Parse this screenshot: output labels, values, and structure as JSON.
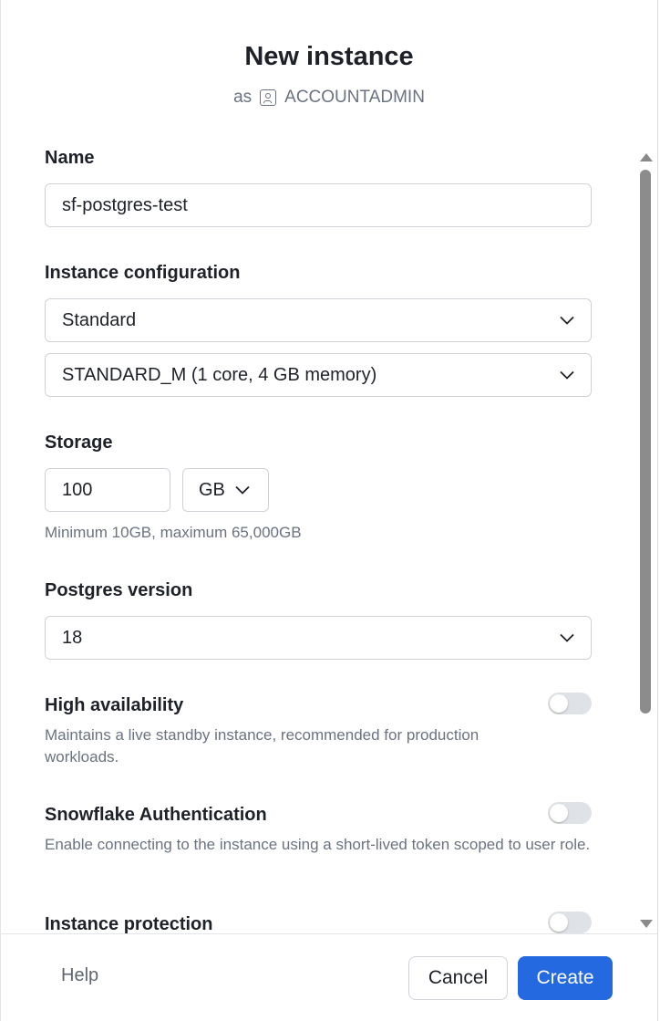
{
  "dialog": {
    "title": "New instance",
    "subtitle_prefix": "as",
    "role": "ACCOUNTADMIN",
    "role_icon": "user-badge-icon"
  },
  "form": {
    "name": {
      "label": "Name",
      "value": "sf-postgres-test"
    },
    "instance_configuration": {
      "label": "Instance configuration",
      "family_value": "Standard",
      "size_value": "STANDARD_M (1 core, 4 GB memory)"
    },
    "storage": {
      "label": "Storage",
      "value": "100",
      "unit": "GB",
      "help": "Minimum 10GB, maximum 65,000GB"
    },
    "postgres_version": {
      "label": "Postgres version",
      "value": "18"
    },
    "high_availability": {
      "label": "High availability",
      "description": "Maintains a live standby instance, recommended for production workloads.",
      "enabled": false
    },
    "snowflake_authentication": {
      "label": "Snowflake Authentication",
      "description": "Enable connecting to the instance using a short-lived token scoped to user role.",
      "enabled": false
    },
    "instance_protection": {
      "label": "Instance protection",
      "enabled": false
    }
  },
  "footer": {
    "help_label": "Help",
    "cancel_label": "Cancel",
    "create_label": "Create"
  },
  "colors": {
    "primary": "#2469df",
    "toggle_off": "#dfe2e6",
    "muted_text": "#6b7280"
  }
}
